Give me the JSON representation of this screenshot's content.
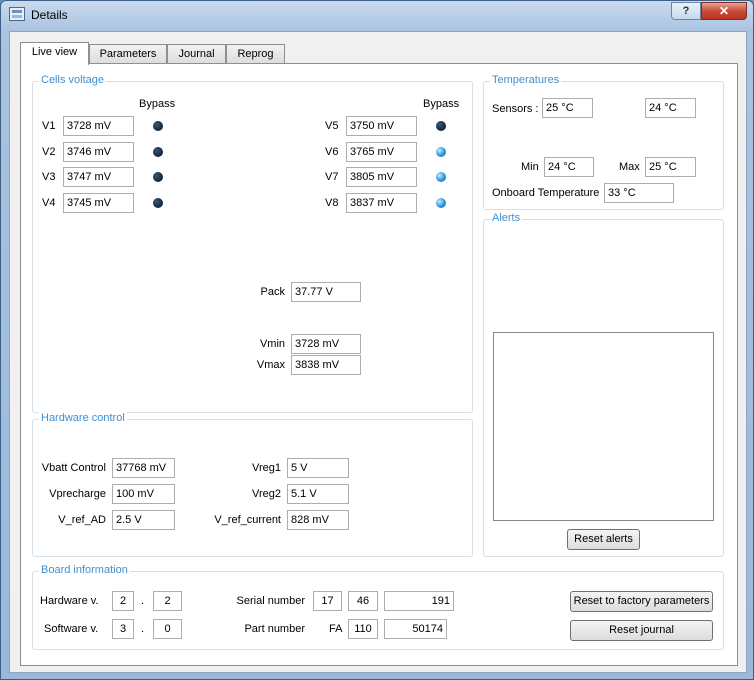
{
  "window": {
    "title": "Details",
    "help_label": "?",
    "close_label": "✕"
  },
  "tabs": [
    "Live view",
    "Parameters",
    "Journal",
    "Reprog"
  ],
  "cells_voltage": {
    "title": "Cells voltage",
    "bypass_label": "Bypass",
    "cells": [
      {
        "label": "V1",
        "value": "3728 mV",
        "bypass": false
      },
      {
        "label": "V2",
        "value": "3746 mV",
        "bypass": false
      },
      {
        "label": "V3",
        "value": "3747 mV",
        "bypass": false
      },
      {
        "label": "V4",
        "value": "3745 mV",
        "bypass": false
      },
      {
        "label": "V5",
        "value": "3750 mV",
        "bypass": false
      },
      {
        "label": "V6",
        "value": "3765 mV",
        "bypass": true
      },
      {
        "label": "V7",
        "value": "3805 mV",
        "bypass": true
      },
      {
        "label": "V8",
        "value": "3837 mV",
        "bypass": true
      }
    ],
    "pack_label": "Pack",
    "pack_value": "37.77 V",
    "vmin_label": "Vmin",
    "vmin_value": "3728 mV",
    "vmax_label": "Vmax",
    "vmax_value": "3838 mV"
  },
  "temperatures": {
    "title": "Temperatures",
    "sensors_label": "Sensors :",
    "sensor1": "25 °C",
    "sensor2": "24 °C",
    "min_label": "Min",
    "min_value": "24 °C",
    "max_label": "Max",
    "max_value": "25 °C",
    "onboard_label": "Onboard Temperature",
    "onboard_value": "33 °C"
  },
  "alerts": {
    "title": "Alerts",
    "reset_label": "Reset alerts"
  },
  "hardware_control": {
    "title": "Hardware control",
    "vbatt_label": "Vbatt Control",
    "vbatt_value": "37768 mV",
    "vprecharge_label": "Vprecharge",
    "vprecharge_value": "100 mV",
    "vref_ad_label": "V_ref_AD",
    "vref_ad_value": "2.5 V",
    "vreg1_label": "Vreg1",
    "vreg1_value": "5 V",
    "vreg2_label": "Vreg2",
    "vreg2_value": "5.1 V",
    "vref_current_label": "V_ref_current",
    "vref_current_value": "828 mV"
  },
  "board_info": {
    "title": "Board information",
    "hw_label": "Hardware v.",
    "hw_major": "2",
    "hw_minor": "2",
    "sw_label": "Software v.",
    "sw_major": "3",
    "sw_minor": "0",
    "dot": ".",
    "serial_label": "Serial number",
    "serial_1": "17",
    "serial_2": "46",
    "serial_3": "191",
    "part_label": "Part number",
    "part_prefix": "FA",
    "part_1": "110",
    "part_2": "50174",
    "reset_factory_label": "Reset to factory parameters",
    "reset_journal_label": "Reset journal"
  },
  "colors": {
    "group_title": "#3f8fd2",
    "led_on": "#2a95de",
    "led_off": "#10253a"
  }
}
